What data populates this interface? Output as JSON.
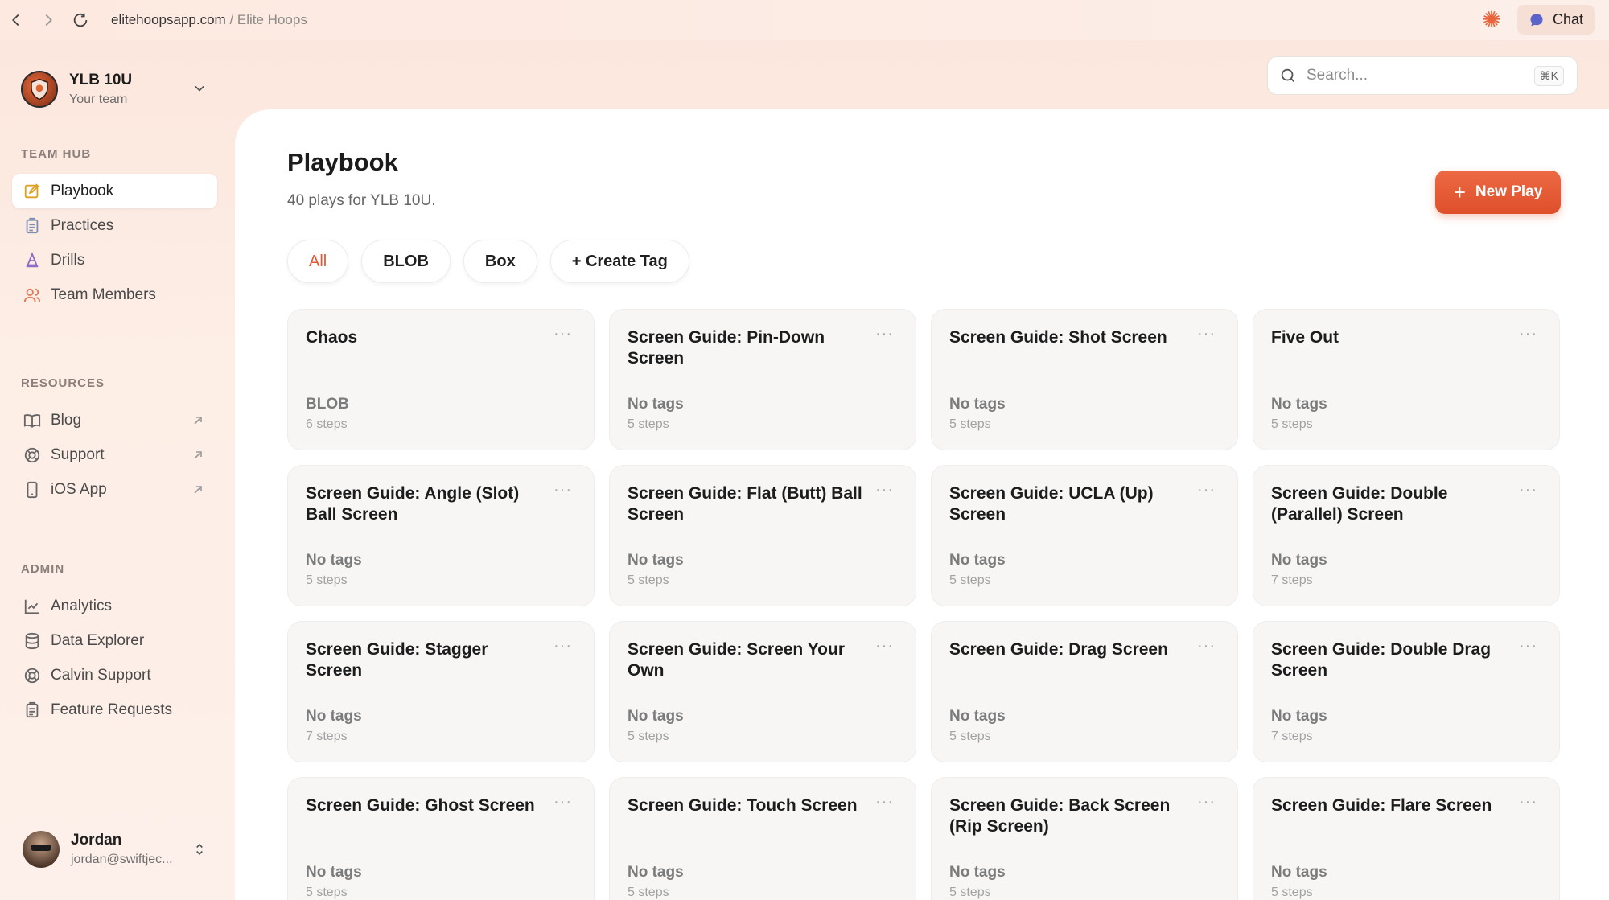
{
  "browser": {
    "url_domain": "elitehoopsapp.com",
    "url_path": " / Elite Hoops",
    "chat_label": "Chat"
  },
  "sidebar": {
    "team_name": "YLB 10U",
    "team_sub": "Your team",
    "sections": [
      {
        "label": "TEAM HUB",
        "items": [
          {
            "label": "Playbook",
            "icon": "edit-icon",
            "active": true
          },
          {
            "label": "Practices",
            "icon": "clipboard-icon"
          },
          {
            "label": "Drills",
            "icon": "cone-icon"
          },
          {
            "label": "Team Members",
            "icon": "users-icon"
          }
        ]
      },
      {
        "label": "RESOURCES",
        "items": [
          {
            "label": "Blog",
            "icon": "book-icon",
            "external": true
          },
          {
            "label": "Support",
            "icon": "lifebuoy-icon",
            "external": true
          },
          {
            "label": "iOS App",
            "icon": "phone-icon",
            "external": true
          }
        ]
      },
      {
        "label": "ADMIN",
        "items": [
          {
            "label": "Analytics",
            "icon": "chart-icon"
          },
          {
            "label": "Data Explorer",
            "icon": "database-icon"
          },
          {
            "label": "Calvin Support",
            "icon": "lifebuoy-icon"
          },
          {
            "label": "Feature Requests",
            "icon": "clipboard-icon"
          }
        ]
      }
    ],
    "user": {
      "name": "Jordan",
      "email": "jordan@swiftjec..."
    }
  },
  "search": {
    "placeholder": "Search...",
    "shortcut": "⌘K"
  },
  "main": {
    "title": "Playbook",
    "subtitle": "40 plays for YLB 10U.",
    "new_play_label": "New Play",
    "tags": [
      {
        "label": "All",
        "active": true
      },
      {
        "label": "BLOB"
      },
      {
        "label": "Box"
      },
      {
        "label": "+ Create Tag"
      }
    ],
    "plays": [
      {
        "title": "Chaos",
        "tags": "BLOB",
        "steps": "6 steps"
      },
      {
        "title": "Screen Guide: Pin-Down Screen",
        "tags": "No tags",
        "steps": "5 steps"
      },
      {
        "title": "Screen Guide: Shot Screen",
        "tags": "No tags",
        "steps": "5 steps"
      },
      {
        "title": "Five Out",
        "tags": "No tags",
        "steps": "5 steps"
      },
      {
        "title": "Screen Guide: Angle (Slot) Ball Screen",
        "tags": "No tags",
        "steps": "5 steps"
      },
      {
        "title": "Screen Guide: Flat (Butt) Ball Screen",
        "tags": "No tags",
        "steps": "5 steps"
      },
      {
        "title": "Screen Guide: UCLA (Up) Screen",
        "tags": "No tags",
        "steps": "5 steps"
      },
      {
        "title": "Screen Guide: Double (Parallel) Screen",
        "tags": "No tags",
        "steps": "7 steps"
      },
      {
        "title": "Screen Guide: Stagger Screen",
        "tags": "No tags",
        "steps": "7 steps"
      },
      {
        "title": "Screen Guide: Screen Your Own",
        "tags": "No tags",
        "steps": "5 steps"
      },
      {
        "title": "Screen Guide: Drag Screen",
        "tags": "No tags",
        "steps": "5 steps"
      },
      {
        "title": "Screen Guide: Double Drag Screen",
        "tags": "No tags",
        "steps": "7 steps"
      },
      {
        "title": "Screen Guide: Ghost Screen",
        "tags": "No tags",
        "steps": "5 steps"
      },
      {
        "title": "Screen Guide: Touch Screen",
        "tags": "No tags",
        "steps": "5 steps"
      },
      {
        "title": "Screen Guide: Back Screen (Rip Screen)",
        "tags": "No tags",
        "steps": "5 steps"
      },
      {
        "title": "Screen Guide: Flare Screen",
        "tags": "No tags",
        "steps": "5 steps"
      }
    ]
  },
  "colors": {
    "accent": "#e05a35",
    "active_icon": "#e0a020"
  }
}
